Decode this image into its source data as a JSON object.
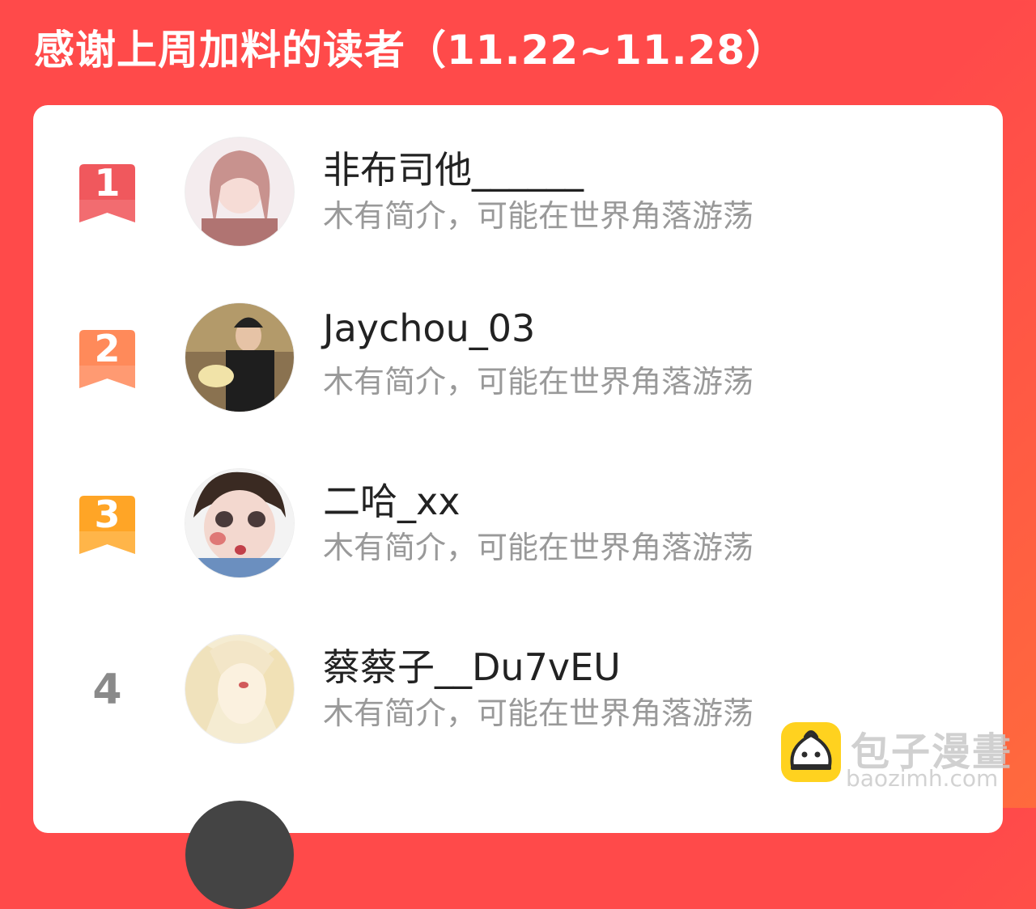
{
  "header": {
    "title": "感谢上周加料的读者（11.22~11.28）"
  },
  "readers": [
    {
      "rank": "1",
      "username": "非布司他______",
      "bio": "木有简介，可能在世界角落游荡"
    },
    {
      "rank": "2",
      "username": "Jaychou_03",
      "bio": "木有简介，可能在世界角落游荡"
    },
    {
      "rank": "3",
      "username": "二哈_xx",
      "bio": "木有简介，可能在世界角落游荡"
    },
    {
      "rank": "4",
      "username": "蔡蔡子__Du7vEU",
      "bio": "木有简介，可能在世界角落游荡"
    }
  ],
  "watermark": {
    "name": "包子漫畫",
    "url": "baozimh.com"
  },
  "colors": {
    "background": "#ff4a4a",
    "rank1": "#f0585d",
    "rank2": "#ff8a5a",
    "rank3": "#ffa526",
    "rank_other": "#8a8a8a"
  }
}
